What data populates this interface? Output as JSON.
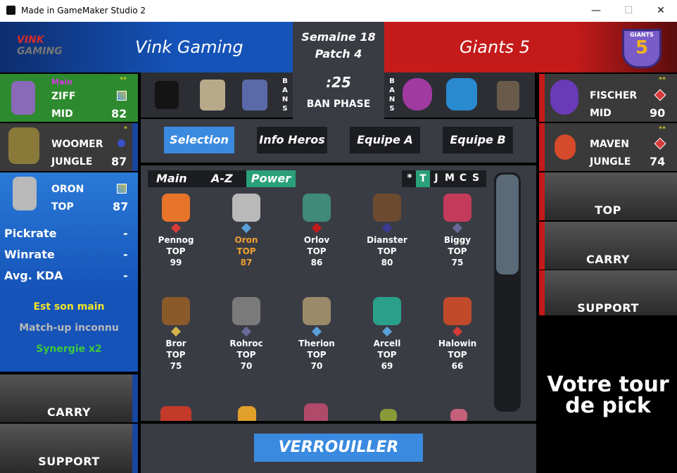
{
  "window": {
    "title": "Made in GameMaker Studio 2",
    "minimize": "—",
    "maximize": "☐",
    "close": "✕"
  },
  "header": {
    "team_a": {
      "logo_top": "VINK",
      "logo_bottom": "GAMING",
      "name": "Vink Gaming"
    },
    "team_b": {
      "name": "Giants 5",
      "badge_top": "GIANTS",
      "badge_num": "5"
    },
    "week": "Semaine 18",
    "patch": "Patch 4",
    "timer": ":25",
    "phase": "BAN PHASE",
    "bans_label": [
      "B",
      "A",
      "N",
      "S"
    ]
  },
  "team_a_players": [
    {
      "name": "ZIFF",
      "role": "MID",
      "score": "82",
      "tag": "Main",
      "stars": "**"
    },
    {
      "name": "WOOMER",
      "role": "JUNGLE",
      "score": "87",
      "stars": "*"
    },
    {
      "name": "ORON",
      "role": "TOP",
      "score": "87"
    }
  ],
  "stats": {
    "pickrate": "Pickrate",
    "winrate": "Winrate",
    "kda": "Avg. KDA",
    "dash": "-"
  },
  "synergy": {
    "line1": "Est son main",
    "line2": "Match-up inconnu",
    "line3": "Synergie x2"
  },
  "team_a_slots": [
    "CARRY",
    "SUPPORT"
  ],
  "team_b_players": [
    {
      "name": "FISCHER",
      "role": "MID",
      "score": "90",
      "stars": "**"
    },
    {
      "name": "MAVEN",
      "role": "JUNGLE",
      "score": "74",
      "stars": "**"
    }
  ],
  "team_b_slots": [
    "TOP",
    "CARRY",
    "SUPPORT"
  ],
  "turn_text": "Votre tour de pick",
  "tabs": [
    "Selection",
    "Info Heros",
    "Equipe A",
    "Equipe B"
  ],
  "sort": {
    "main": "Main",
    "az": "A-Z",
    "power": "Power"
  },
  "filters": [
    "*",
    "T",
    "J",
    "M",
    "C",
    "S"
  ],
  "heroes": [
    {
      "name": "Pennog",
      "role": "TOP",
      "power": "99",
      "color": "#e8742a",
      "diamond": "#d63a3a"
    },
    {
      "name": "Oron",
      "role": "TOP",
      "power": "87",
      "color": "#b9b9b9",
      "diamond": "#5aa0d8",
      "highlight": true
    },
    {
      "name": "Orlov",
      "role": "TOP",
      "power": "86",
      "color": "#3f8a78",
      "diamond": "#c41a1a"
    },
    {
      "name": "Dianster",
      "role": "TOP",
      "power": "80",
      "color": "#6b4a2f",
      "diamond": "#3a3a9a"
    },
    {
      "name": "Biggy",
      "role": "TOP",
      "power": "75",
      "color": "#c43a5a",
      "diamond": "#6a6a9a"
    },
    {
      "name": "Bror",
      "role": "TOP",
      "power": "75",
      "color": "#8a5a2a",
      "diamond": "#d6b24a"
    },
    {
      "name": "Rohroc",
      "role": "TOP",
      "power": "70",
      "color": "#7a7a7a",
      "diamond": "#6a6a9a"
    },
    {
      "name": "Therion",
      "role": "TOP",
      "power": "70",
      "color": "#9a8a6a",
      "diamond": "#5aa0d8"
    },
    {
      "name": "Arcell",
      "role": "TOP",
      "power": "69",
      "color": "#2aa08a",
      "diamond": "#5aa0d8"
    },
    {
      "name": "Halowin",
      "role": "TOP",
      "power": "66",
      "color": "#c04a2a",
      "diamond": "#d63a3a"
    }
  ],
  "lock_button": "VERROUILLER"
}
